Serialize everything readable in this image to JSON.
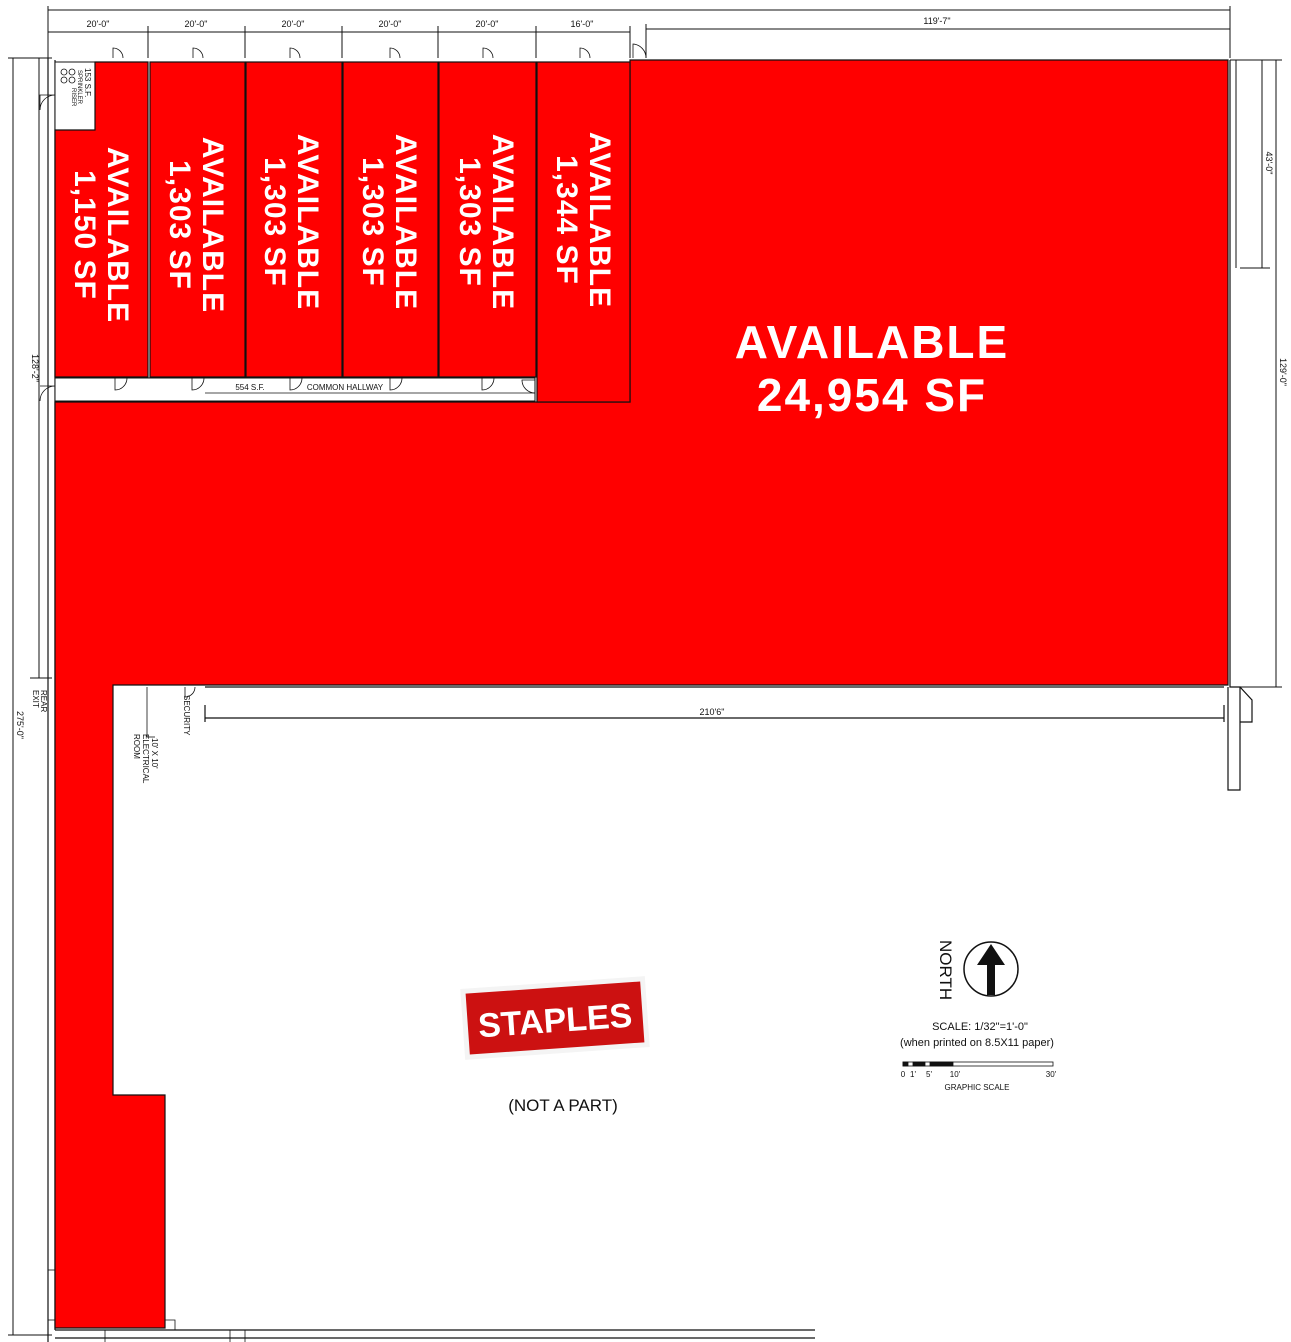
{
  "top_dimensions": [
    "20'-0\"",
    "20'-0\"",
    "20'-0\"",
    "20'-0\"",
    "20'-0\"",
    "16'-0\"",
    "119'-7\""
  ],
  "right_dimensions": {
    "upper": "43'-0\"",
    "overall": "129'-0\""
  },
  "left_dimensions": {
    "upper": "128'-2\"",
    "overall": "275'-0\""
  },
  "bottom_dimension": "210'6\"",
  "units": [
    {
      "status": "AVAILABLE",
      "area": "1,150 SF"
    },
    {
      "status": "AVAILABLE",
      "area": "1,303 SF"
    },
    {
      "status": "AVAILABLE",
      "area": "1,303 SF"
    },
    {
      "status": "AVAILABLE",
      "area": "1,303 SF"
    },
    {
      "status": "AVAILABLE",
      "area": "1,303 SF"
    },
    {
      "status": "AVAILABLE",
      "area": "1,344 SF"
    }
  ],
  "main_space": {
    "status": "AVAILABLE",
    "area": "24,954 SF"
  },
  "hallway": {
    "area": "554 S.F.",
    "label": "COMMON HALLWAY"
  },
  "sprinkler_room": {
    "area": "153 S.F.",
    "label_line1": "SPRINKLER",
    "label_line2": "RISER"
  },
  "rooms": {
    "security": "SECURITY",
    "electrical_line1": "10' X 10'",
    "electrical_line2": "ELECTRICAL",
    "electrical_line3": "ROOM",
    "rear_exit_line1": "REAR",
    "rear_exit_line2": "EXIT"
  },
  "tenant": {
    "name": "STAPLES",
    "note": "(NOT A PART)"
  },
  "north_label": "NORTH",
  "scale": {
    "line1": "SCALE: 1/32\"=1'-0\"",
    "line2": "(when printed on 8.5X11 paper)",
    "ticks": [
      "0",
      "1'",
      "5'",
      "10'",
      "30'"
    ],
    "caption": "GRAPHIC SCALE"
  },
  "colors": {
    "available": "#ff0000",
    "outline": "#111111"
  }
}
